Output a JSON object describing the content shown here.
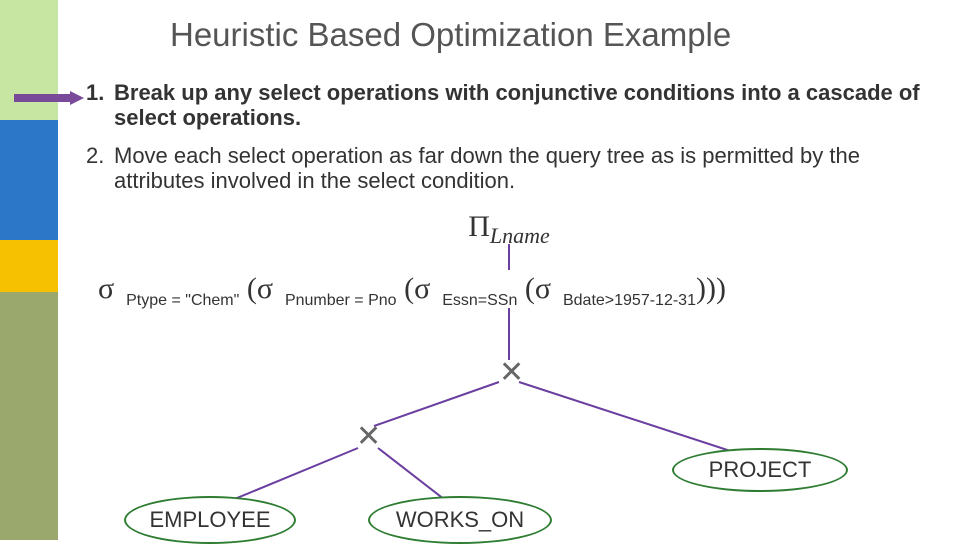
{
  "title": "Heuristic Based Optimization Example",
  "steps": [
    {
      "num": "1.",
      "text": "Break up any select operations with conjunctive conditions into a cascade of select operations.",
      "bold": true
    },
    {
      "num": "2.",
      "text": "Move each select operation as far down the query tree as is permitted by the attributes involved in the select condition.",
      "bold": false
    }
  ],
  "projection": {
    "op": "Π",
    "attr": "Lname"
  },
  "selection": {
    "sigma": "σ",
    "c1": "Ptype = \"Chem\"",
    "c2": "Pnumber = Pno",
    "c3": "Essn=SSn",
    "c4": "Bdate>1957-12-31",
    "open": "(",
    "close3": ")))"
  },
  "cross": "✕",
  "leaves": {
    "project": "PROJECT",
    "employee": "EMPLOYEE",
    "works_on": "WORKS_ON"
  },
  "colors": {
    "edge": "#6b3fa0",
    "leaf_border": "#2e7d32"
  }
}
